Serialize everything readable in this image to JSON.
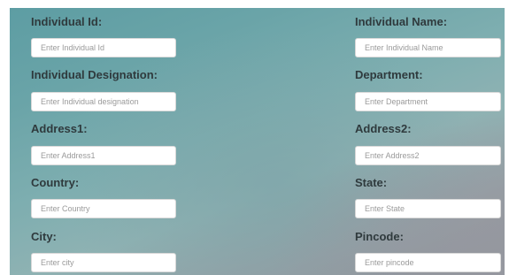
{
  "form": {
    "fields": [
      {
        "label": "Individual Id:",
        "placeholder": "Enter Individual Id",
        "value": ""
      },
      {
        "label": "Individual Name:",
        "placeholder": "Enter Individual Name",
        "value": ""
      },
      {
        "label": "Individual Designation:",
        "placeholder": "Enter Individual designation",
        "value": ""
      },
      {
        "label": "Department:",
        "placeholder": "Enter Department",
        "value": ""
      },
      {
        "label": "Address1:",
        "placeholder": "Enter Address1",
        "value": ""
      },
      {
        "label": "Address2:",
        "placeholder": "Enter Address2",
        "value": ""
      },
      {
        "label": "Country:",
        "placeholder": "Enter Country",
        "value": ""
      },
      {
        "label": "State:",
        "placeholder": "Enter State",
        "value": ""
      },
      {
        "label": "City:",
        "placeholder": "Enter city",
        "value": ""
      },
      {
        "label": "Pincode:",
        "placeholder": "Enter pincode",
        "value": ""
      }
    ]
  },
  "colors": {
    "label_text": "#2f3a3d",
    "panel_teal": "#6aa4a8",
    "panel_grey": "#979fa5",
    "input_background": "#ffffff",
    "placeholder_text": "#9a9a9a"
  }
}
